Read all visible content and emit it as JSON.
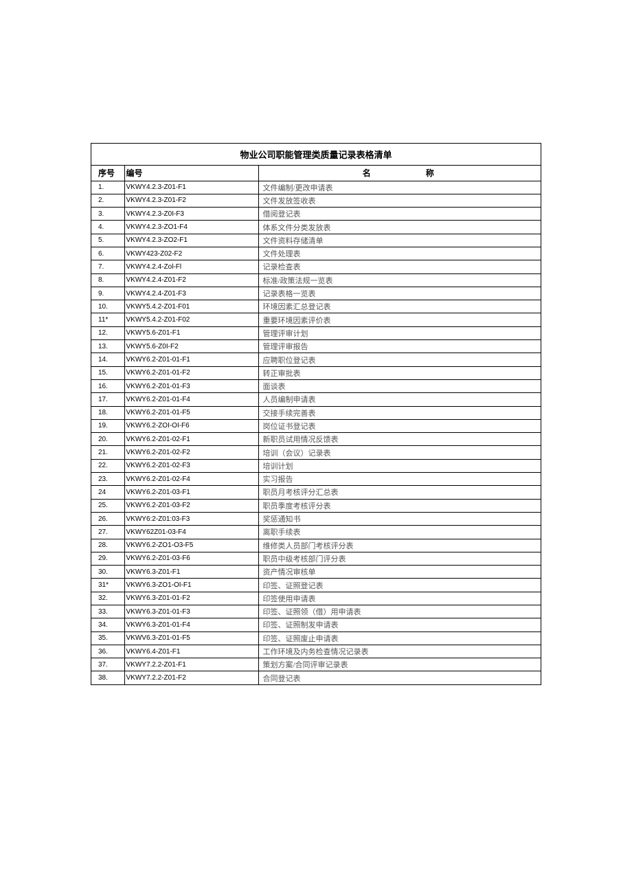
{
  "title": "物业公司职能管理类质量记录表格清单",
  "headers": {
    "seq": "序号",
    "code": "编号",
    "name": "名称"
  },
  "rows": [
    {
      "seq": "1.",
      "code": "VKWY4.2.3-Z01-F1",
      "name": "文件编制/更改申请表"
    },
    {
      "seq": "2.",
      "code": "VKWY4.2.3-Z01-F2",
      "name": "文件发放签收表"
    },
    {
      "seq": "3.",
      "code": "VKWY4.2.3-Z0I-F3",
      "name": "借阅登记表"
    },
    {
      "seq": "4.",
      "code": "VKWY4.2.3-ZO1-F4",
      "name": "体系文件分类发放表"
    },
    {
      "seq": "5.",
      "code": "VKWY4.2.3-ZO2-F1",
      "name": "文件资料存储清单"
    },
    {
      "seq": "6.",
      "code": "VKWY423-Z02-F2",
      "name": "文件处理表"
    },
    {
      "seq": "7.",
      "code": "VKWY4.2.4-Zol-Fl",
      "name": "记录检查表"
    },
    {
      "seq": "8.",
      "code": "VKWY4.2.4-Z01-F2",
      "name": "标准/政策法规一览表"
    },
    {
      "seq": "9.",
      "code": "VKWY4.2.4-Z01-F3",
      "name": "记录表格一览表"
    },
    {
      "seq": "10.",
      "code": "VKWY5.4.2-Z01-F01",
      "name": "环境因素汇总登记表"
    },
    {
      "seq": "11*",
      "code": "VKWY5.4.2-Z01-F02",
      "name": "重要环境因素评价表"
    },
    {
      "seq": "12.",
      "code": "VKWY5.6-Z01-F1",
      "name": "管理评审计划"
    },
    {
      "seq": "13.",
      "code": "VKWY5.6-Z0I-F2",
      "name": "管理评审报告"
    },
    {
      "seq": "14.",
      "code": "VKWY6.2-Z01-01-F1",
      "name": "应聘职位登记表"
    },
    {
      "seq": "15.",
      "code": "VKWY6.2-Z01-01-F2",
      "name": "转正审批表"
    },
    {
      "seq": "16.",
      "code": "VKWY6.2-Z01-01-F3",
      "name": "面谈表"
    },
    {
      "seq": "17.",
      "code": "VKWY6.2-Z01-01-F4",
      "name": "人员编制申请表"
    },
    {
      "seq": "18.",
      "code": "VKWY6.2-Z01-01-F5",
      "name": "交接手续完善表"
    },
    {
      "seq": "19.",
      "code": "VKWY6.2-ZOI-OI-F6",
      "name": "岗位证书登记表"
    },
    {
      "seq": "20.",
      "code": "VKWY6.2-Z01-02-F1",
      "name": "新职员试用情况反馈表"
    },
    {
      "seq": "21.",
      "code": "VKWY6.2-Z01-02-F2",
      "name": "培训（会议）记录表"
    },
    {
      "seq": "22.",
      "code": "VKWY6.2-Z01-02-F3",
      "name": "培训计划"
    },
    {
      "seq": "23.",
      "code": "VKWY6.2-Z01-02-F4",
      "name": "实习报告"
    },
    {
      "seq": "24",
      "code": "VKWY6.2-Z01-03-F1",
      "name": "职员月考核评分汇总表"
    },
    {
      "seq": "25.",
      "code": "VKWY6.2-Z01-03-F2",
      "name": "职员季度考核评分表"
    },
    {
      "seq": "26.",
      "code": "VKWY6:2-Z01:03-F3",
      "name": "奖惩通知书"
    },
    {
      "seq": "27.",
      "code": "VKWY62Z01-03-F4",
      "name": "离职手续表"
    },
    {
      "seq": "28.",
      "code": "VKWY6.2-ZO1-O3-F5",
      "name": "维修类人员部门考核评分表"
    },
    {
      "seq": "29.",
      "code": "VKWY6.2-Z01-03-F6",
      "name": "职员中级考核部门评分表"
    },
    {
      "seq": "30.",
      "code": "VKWY6.3-Z01-F1",
      "name": "资产情况审核单"
    },
    {
      "seq": "31*",
      "code": "VKWY6.3-ZO1-OI-F1",
      "name": "印签、证照登记表"
    },
    {
      "seq": "32.",
      "code": "VKWY6.3-Z01-01-F2",
      "name": "印签使用申请表"
    },
    {
      "seq": "33.",
      "code": "VKWY6.3-Z01-01-F3",
      "name": "印签、证照领（借）用申请表"
    },
    {
      "seq": "34.",
      "code": "VKWY6.3-Z01-01-F4",
      "name": "印签、证照制发申请表"
    },
    {
      "seq": "35.",
      "code": "VKWV6.3-Z01-01-F5",
      "name": "印签、证照废止申请表"
    },
    {
      "seq": "36.",
      "code": "VKWY6.4-Z01-F1",
      "name": "工作环境及内务检查情况记录表"
    },
    {
      "seq": "37.",
      "code": "VKWY7.2.2-Z01-F1",
      "name": "策划方案/合同评审记录表"
    },
    {
      "seq": "38.",
      "code": "VKWY7.2.2-Z01-F2",
      "name": "合同登记表"
    }
  ]
}
